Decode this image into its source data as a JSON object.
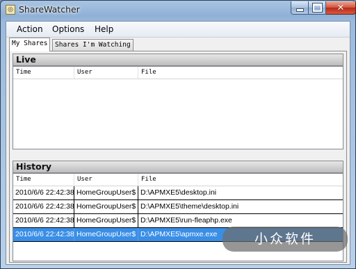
{
  "window": {
    "title": "ShareWatcher",
    "app_icon": "magnifier-folder-icon",
    "caption_buttons": [
      "minimize-icon",
      "maximize-icon",
      "close-icon"
    ]
  },
  "menu": [
    {
      "label": "Action"
    },
    {
      "label": "Options"
    },
    {
      "label": "Help"
    }
  ],
  "tabs": [
    {
      "label": "My Shares",
      "active": true
    },
    {
      "label": "Shares I'm Watching",
      "active": false
    }
  ],
  "live": {
    "title": "Live",
    "columns": [
      "Time",
      "User",
      "File"
    ],
    "rows": []
  },
  "history": {
    "title": "History",
    "columns": [
      "Time",
      "User",
      "File"
    ],
    "rows": [
      {
        "time": "2010/6/6 22:42:38",
        "user": "HomeGroupUser$",
        "file": "D:\\APMXE5\\desktop.ini",
        "selected": false
      },
      {
        "time": "2010/6/6 22:42:38",
        "user": "HomeGroupUser$",
        "file": "D:\\APMXE5\\theme\\desktop.ini",
        "selected": false
      },
      {
        "time": "2010/6/6 22:42:38",
        "user": "HomeGroupUser$",
        "file": "D:\\APMXE5\\run-fleaphp.exe",
        "selected": false
      },
      {
        "time": "2010/6/6 22:42:38",
        "user": "HomeGroupUser$",
        "file": "D:\\APMXE5\\apmxe.exe",
        "selected": true
      }
    ]
  },
  "watermark": {
    "text": "小众软件"
  },
  "colors": {
    "selection": "#3a8ee6",
    "titlebar": "#8fb0d6",
    "close_button": "#c8402a"
  }
}
